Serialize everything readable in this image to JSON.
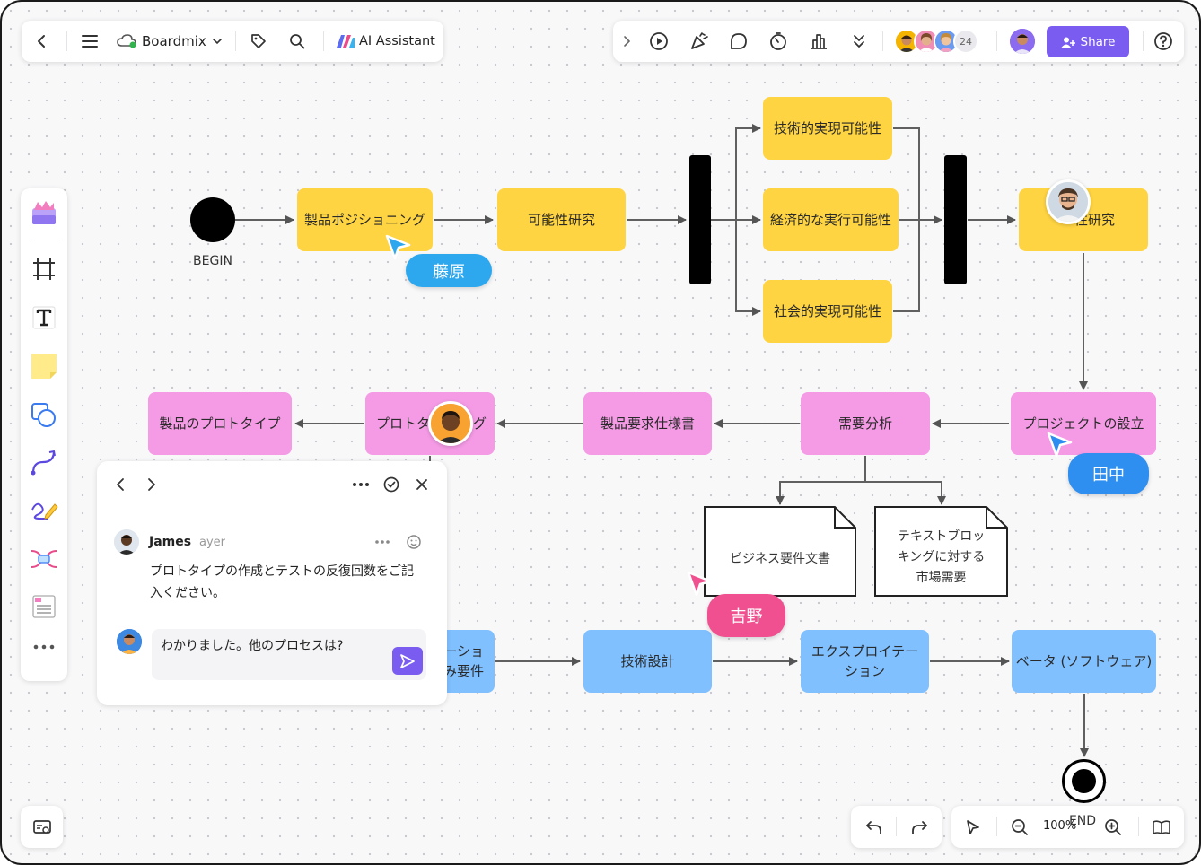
{
  "toolbar_left": {
    "app_name": "Boardmix",
    "ai_label": "AI Assistant"
  },
  "toolbar_right": {
    "collaborator_count": "24",
    "share_label": "Share"
  },
  "colors": {
    "yellow": "#ffd442",
    "pink": "#f59be6",
    "blue": "#80c0ff",
    "accent_purple": "#7b5cf0",
    "cursor_blue": "#2da8ef",
    "cursor_pink": "#f0508f"
  },
  "diagram": {
    "begin_label": "BEGIN",
    "end_label": "END",
    "row1": {
      "product_positioning": "製品ポジショニング",
      "feasibility_study": "可能性研究",
      "technical": "技術的実現可能性",
      "economic": "経済的な実行可能性",
      "social": "社会的実現可能性",
      "research_partial": "性研究"
    },
    "row2": {
      "project_setup": "プロジェクトの設立",
      "demand_analysis": "需要分析",
      "requirements_spec": "製品要求仕様書",
      "prototyping_left": "プロトタ",
      "prototyping_right": "グ",
      "product_prototype": "製品のプロトタイプ"
    },
    "docs": {
      "business_doc": "ビジネス要件文書",
      "market_line1": "テキストブロッ",
      "market_line2": "キングに対する",
      "market_line3": "市場需要"
    },
    "row3": {
      "partial_line1": "ーショ",
      "partial_line2": "み要件",
      "tech_design": "技術設計",
      "exploitation_line1": "エクスプロイテー",
      "exploitation_line2": "ション",
      "beta": "ベータ (ソフトウェア)"
    }
  },
  "cursors": {
    "fujiwara": "藤原",
    "tanaka": "田中",
    "yoshino": "吉野"
  },
  "comment": {
    "author": "James",
    "time": "ayer",
    "message_line1": "プロトタイプの作成とテストの反復回数をご記",
    "message_line2": "入ください。",
    "reply_value": "わかりました。他のプロセスは?"
  },
  "bottom": {
    "zoom": "100%"
  },
  "icons": {
    "back": "chevron-left-icon",
    "menu": "hamburger-icon",
    "cloud": "cloud-icon",
    "tag": "tag-icon",
    "search": "search-icon",
    "play": "play-icon",
    "celebrate": "party-icon",
    "chat": "comment-icon",
    "timer": "timer-icon",
    "vote": "chart-icon",
    "more": "double-chevron-icon",
    "help": "help-icon"
  }
}
